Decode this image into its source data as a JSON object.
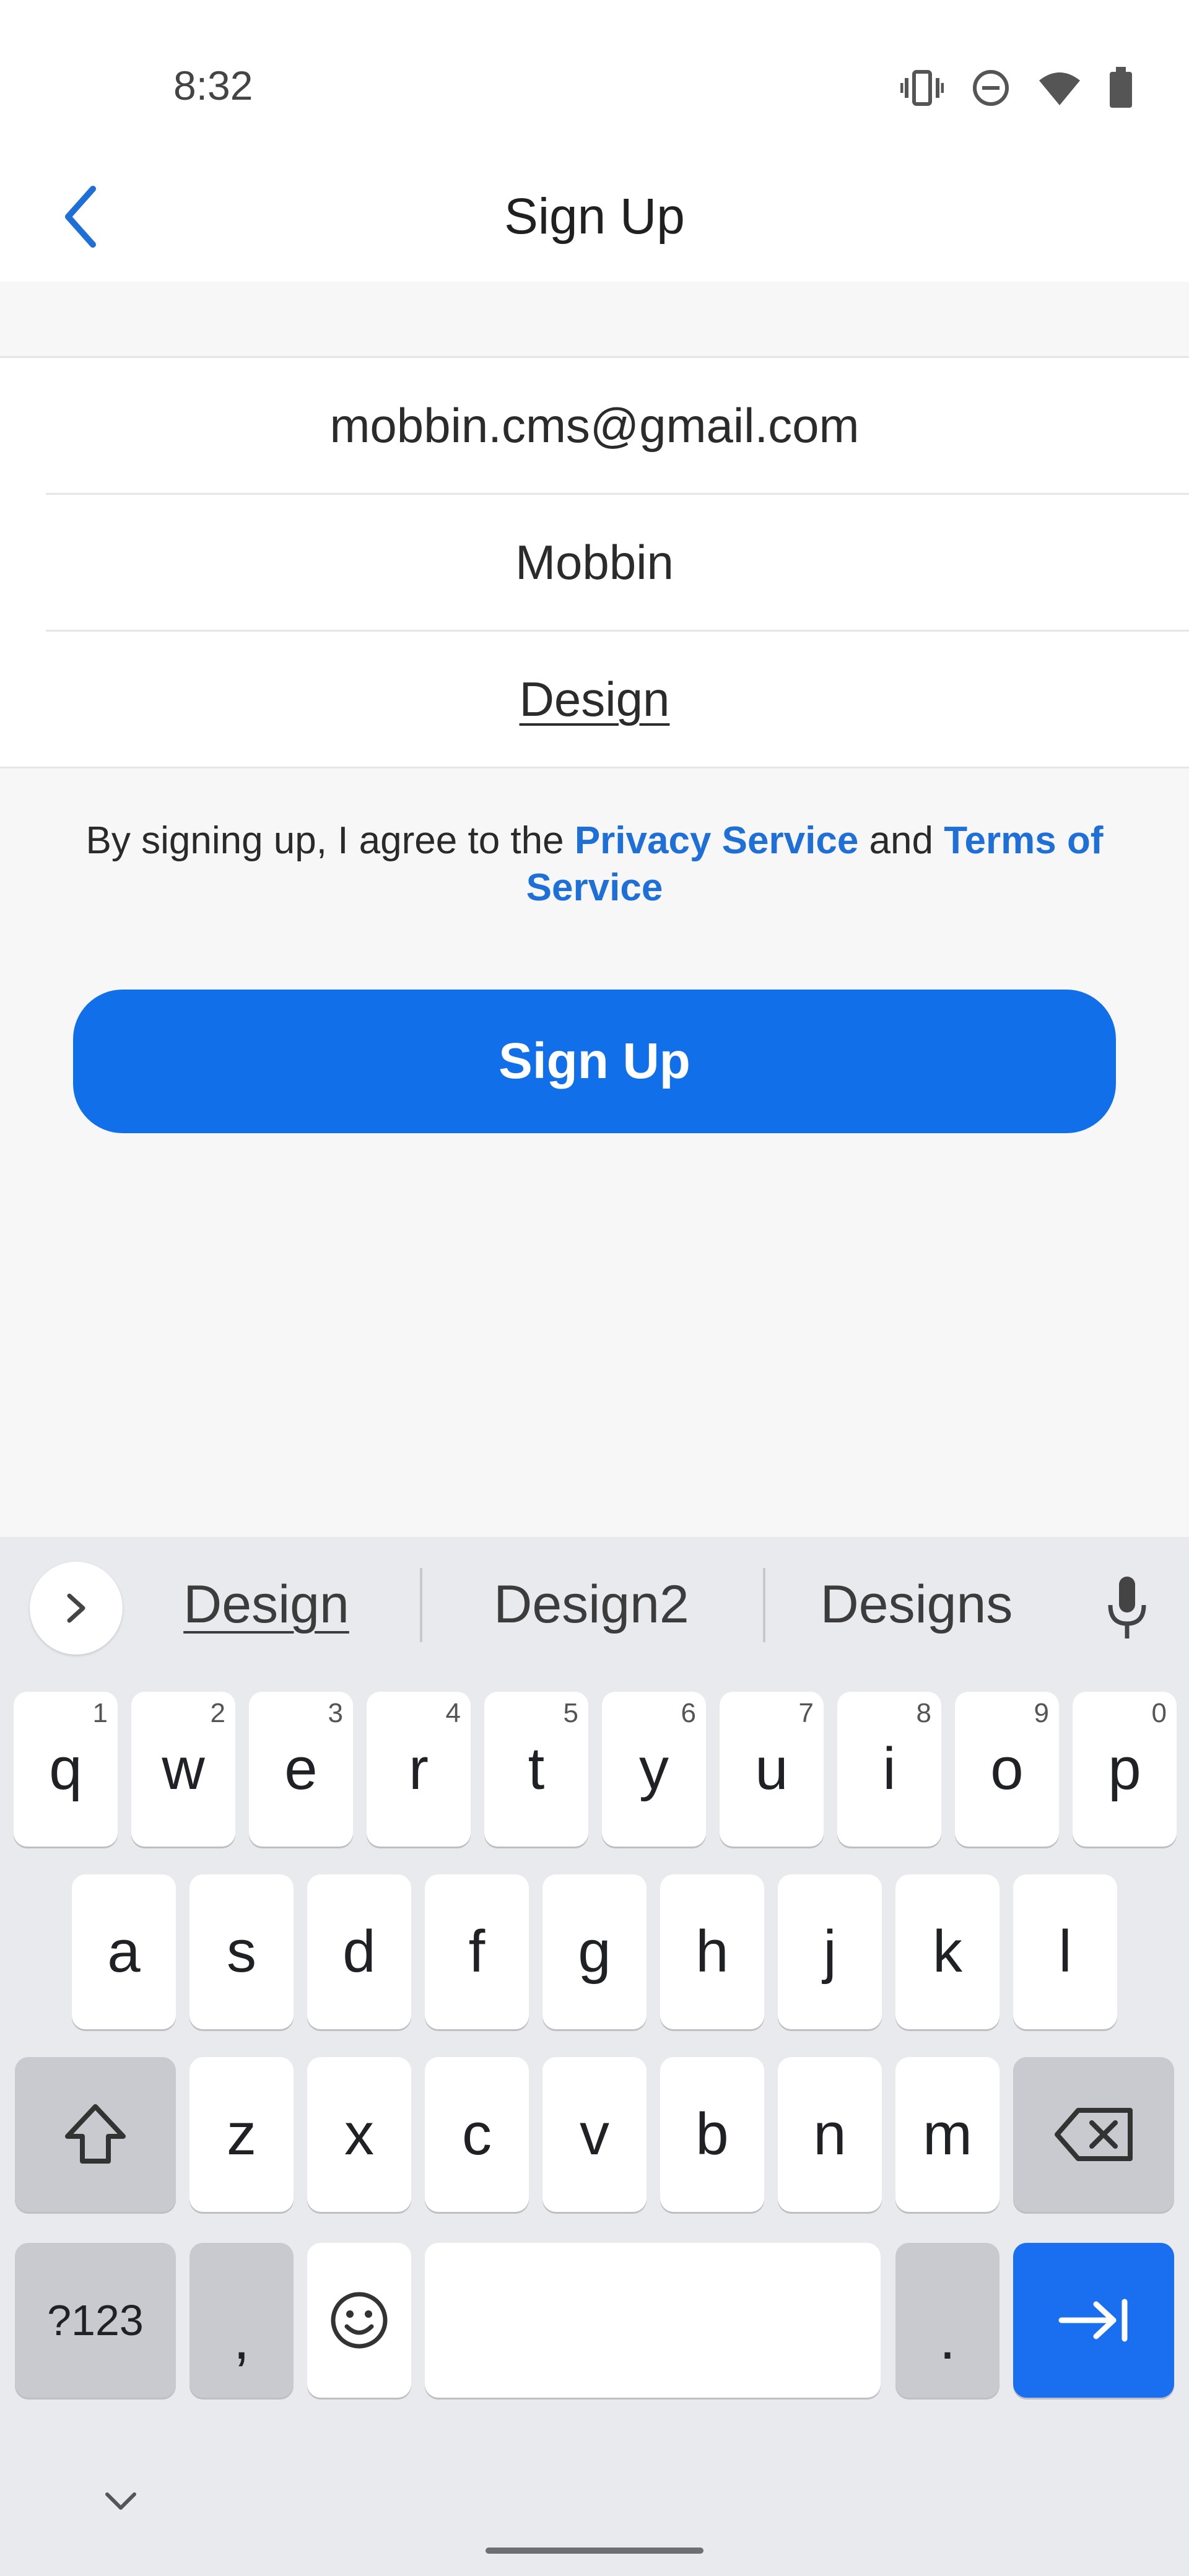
{
  "status_bar": {
    "time": "8:32",
    "icons": [
      "vibrate-icon",
      "do-not-disturb-icon",
      "wifi-icon",
      "battery-icon"
    ]
  },
  "header": {
    "title": "Sign Up",
    "back_icon": "chevron-left-icon"
  },
  "form": {
    "email": "mobbin.cms@gmail.com",
    "name": "Mobbin",
    "active_field": "Design"
  },
  "agreement": {
    "prefix": "By signing up, I agree to the ",
    "privacy_link": "Privacy Service",
    "middle": " and ",
    "terms_link": "Terms of Service"
  },
  "signup_button": {
    "label": "Sign Up"
  },
  "keyboard": {
    "suggestions": [
      "Design",
      "Design2",
      "Designs"
    ],
    "row1": [
      {
        "k": "q",
        "n": "1"
      },
      {
        "k": "w",
        "n": "2"
      },
      {
        "k": "e",
        "n": "3"
      },
      {
        "k": "r",
        "n": "4"
      },
      {
        "k": "t",
        "n": "5"
      },
      {
        "k": "y",
        "n": "6"
      },
      {
        "k": "u",
        "n": "7"
      },
      {
        "k": "i",
        "n": "8"
      },
      {
        "k": "o",
        "n": "9"
      },
      {
        "k": "p",
        "n": "0"
      }
    ],
    "row2": [
      "a",
      "s",
      "d",
      "f",
      "g",
      "h",
      "j",
      "k",
      "l"
    ],
    "row3": [
      "z",
      "x",
      "c",
      "v",
      "b",
      "n",
      "m"
    ],
    "symbols_label": "?123",
    "comma_label": ",",
    "period_label": "."
  },
  "colors": {
    "accent": "#116fe9",
    "link": "#1f6fd9"
  }
}
